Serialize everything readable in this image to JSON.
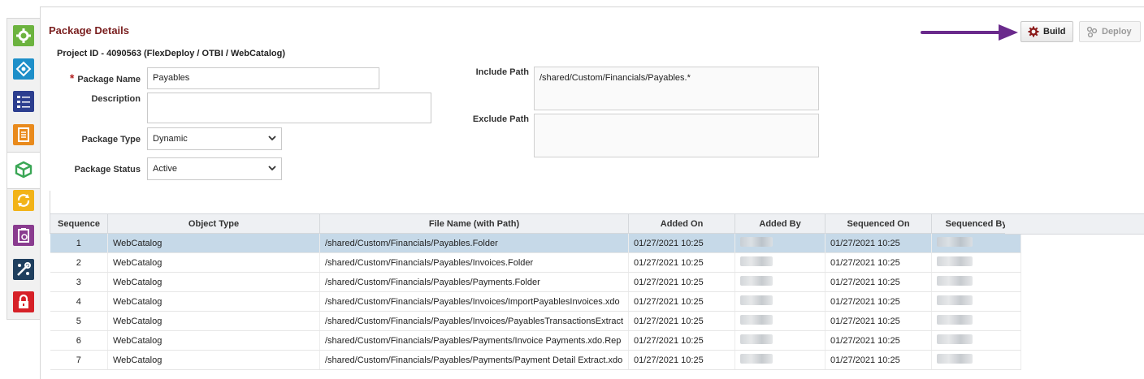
{
  "sidebar": {
    "items": [
      {
        "icon": "gear-icon",
        "color": "#6cb33f"
      },
      {
        "icon": "diamond-network-icon",
        "color": "#1e8fc9"
      },
      {
        "icon": "list-icon",
        "color": "#2c3e8f"
      },
      {
        "icon": "document-icon",
        "color": "#e98a1c"
      },
      {
        "icon": "cube-icon",
        "color": "#3aa655"
      },
      {
        "icon": "sync-icon",
        "color": "#f2b318"
      },
      {
        "icon": "clipboard-icon",
        "color": "#8a3c8f"
      },
      {
        "icon": "tools-icon",
        "color": "#1f3f5e"
      },
      {
        "icon": "lock-icon",
        "color": "#d62128"
      }
    ]
  },
  "header": {
    "title": "Package Details",
    "project_id": "Project ID - 4090563 (FlexDeploy / OTBI / WebCatalog)"
  },
  "toolbar": {
    "build_label": "Build",
    "deploy_label": "Deploy"
  },
  "form": {
    "package_name_label": "Package Name",
    "package_name_value": "Payables",
    "description_label": "Description",
    "description_value": "",
    "package_type_label": "Package Type",
    "package_type_value": "Dynamic",
    "package_status_label": "Package Status",
    "package_status_value": "Active",
    "include_path_label": "Include Path",
    "include_path_value": "/shared/Custom/Financials/Payables.*",
    "exclude_path_label": "Exclude Path",
    "exclude_path_value": ""
  },
  "table": {
    "headers": [
      "Sequence",
      "Object Type",
      "File Name (with Path)",
      "Added On",
      "Added By",
      "Sequenced On",
      "Sequenced By"
    ],
    "rows": [
      {
        "seq": "1",
        "type": "WebCatalog",
        "file": "/shared/Custom/Financials/Payables.Folder",
        "added_on": "01/27/2021 10:25",
        "sequenced_on": "01/27/2021 10:25"
      },
      {
        "seq": "2",
        "type": "WebCatalog",
        "file": "/shared/Custom/Financials/Payables/Invoices.Folder",
        "added_on": "01/27/2021 10:25",
        "sequenced_on": "01/27/2021 10:25"
      },
      {
        "seq": "3",
        "type": "WebCatalog",
        "file": "/shared/Custom/Financials/Payables/Payments.Folder",
        "added_on": "01/27/2021 10:25",
        "sequenced_on": "01/27/2021 10:25"
      },
      {
        "seq": "4",
        "type": "WebCatalog",
        "file": "/shared/Custom/Financials/Payables/Invoices/ImportPayablesInvoices.xdo",
        "added_on": "01/27/2021 10:25",
        "sequenced_on": "01/27/2021 10:25"
      },
      {
        "seq": "5",
        "type": "WebCatalog",
        "file": "/shared/Custom/Financials/Payables/Invoices/PayablesTransactionsExtract",
        "added_on": "01/27/2021 10:25",
        "sequenced_on": "01/27/2021 10:25"
      },
      {
        "seq": "6",
        "type": "WebCatalog",
        "file": "/shared/Custom/Financials/Payables/Payments/Invoice Payments.xdo.Rep",
        "added_on": "01/27/2021 10:25",
        "sequenced_on": "01/27/2021 10:25"
      },
      {
        "seq": "7",
        "type": "WebCatalog",
        "file": "/shared/Custom/Financials/Payables/Payments/Payment Detail Extract.xdo",
        "added_on": "01/27/2021 10:25",
        "sequenced_on": "01/27/2021 10:25"
      }
    ],
    "selected_row_color": "#c6d9e8"
  },
  "colors": {
    "title": "#7a1f1f",
    "arrow": "#6a2a8c",
    "build_icon": "#8b1a1a"
  }
}
